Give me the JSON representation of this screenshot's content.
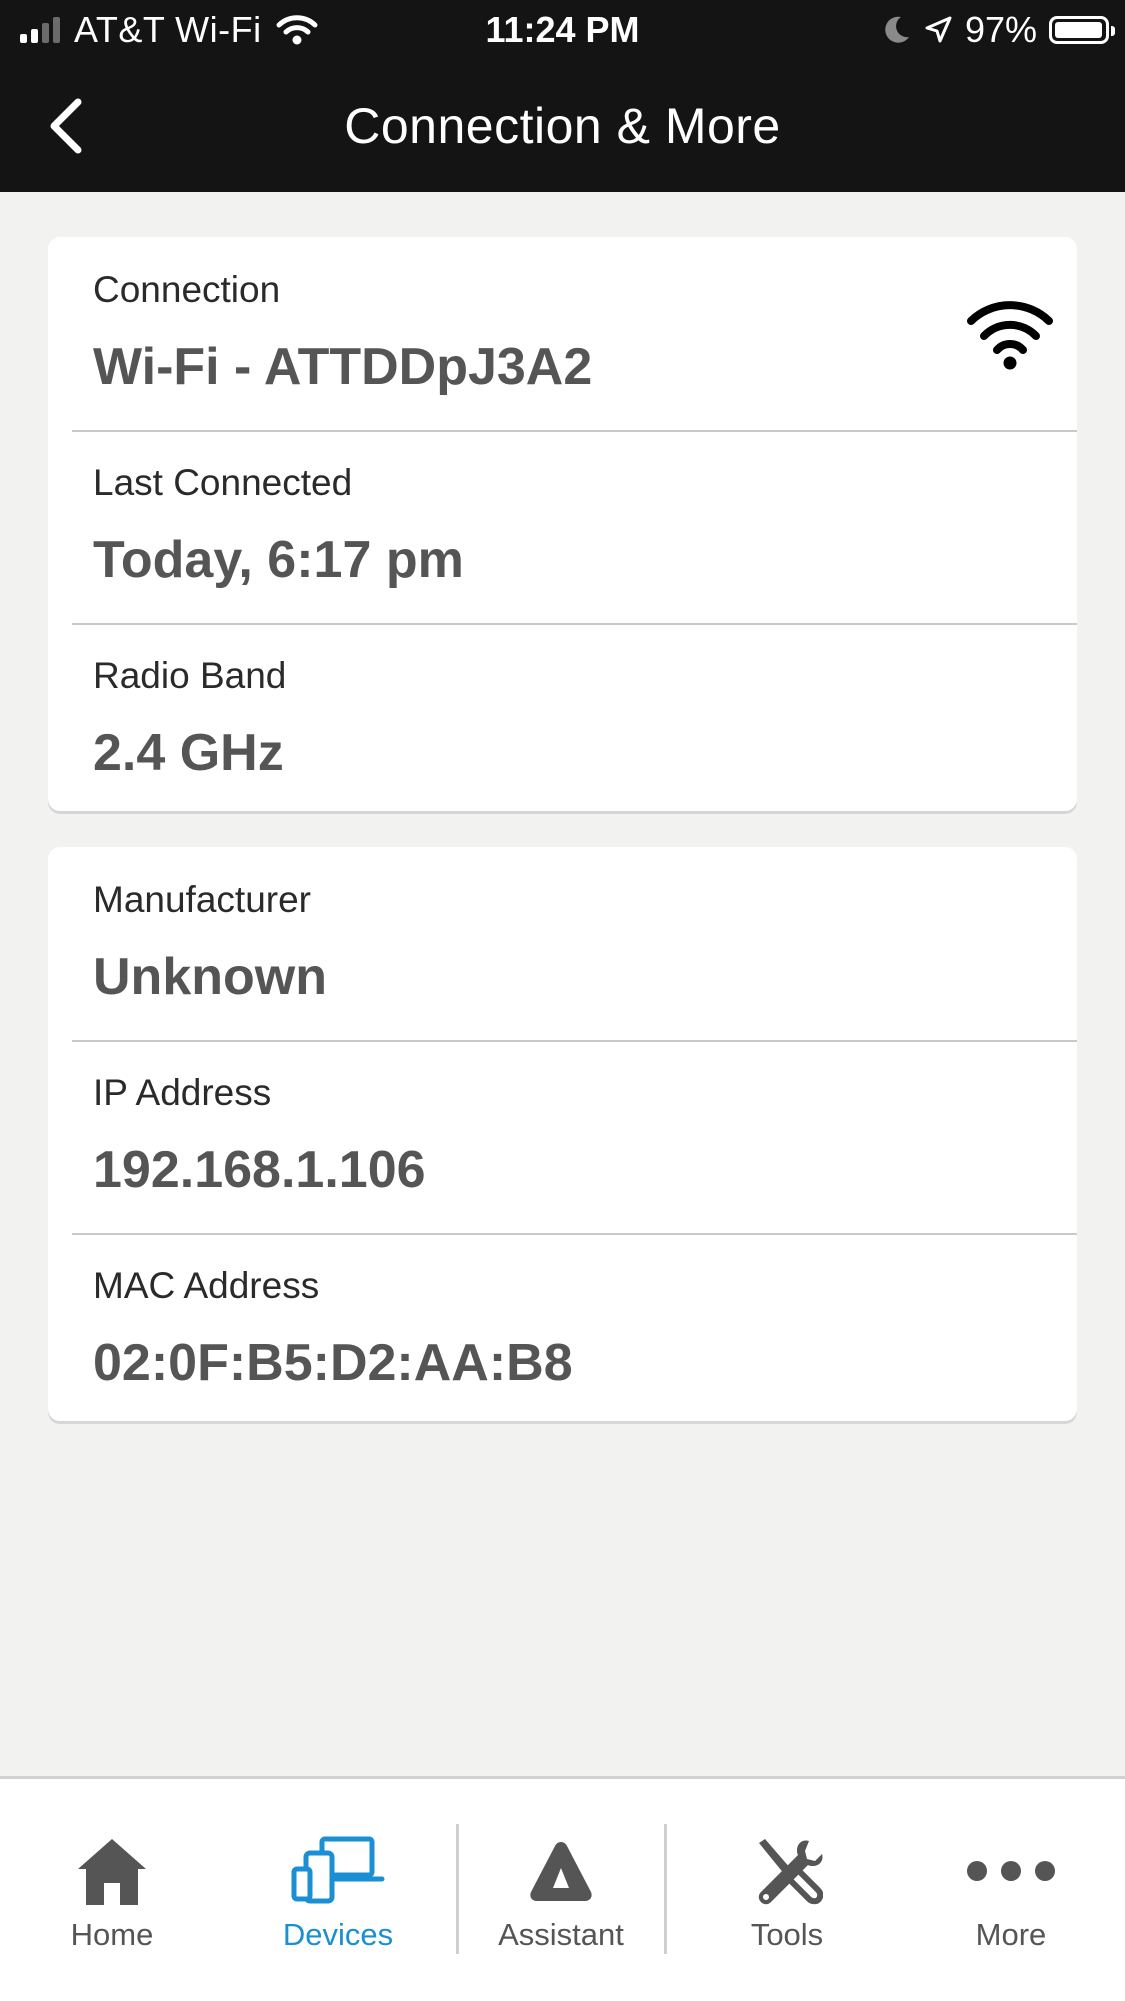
{
  "status_bar": {
    "carrier": "AT&T Wi-Fi",
    "time": "11:24 PM",
    "battery_percent_label": "97%",
    "battery_level": 0.97,
    "signal_bars_active": 2,
    "icons": [
      "signal-icon",
      "wifi-icon",
      "moon-icon",
      "location-arrow-icon",
      "battery-icon"
    ]
  },
  "header": {
    "title": "Connection & More",
    "back_icon": "chevron-left-icon"
  },
  "connection_card": {
    "connection": {
      "label": "Connection",
      "value": "Wi-Fi - ATTDDpJ3A2",
      "icon": "wifi-icon"
    },
    "last_connected": {
      "label": "Last Connected",
      "value": "Today, 6:17 pm"
    },
    "radio_band": {
      "label": "Radio Band",
      "value": "2.4 GHz"
    }
  },
  "device_card": {
    "manufacturer": {
      "label": "Manufacturer",
      "value": "Unknown"
    },
    "ip_address": {
      "label": "IP Address",
      "value": "192.168.1.106"
    },
    "mac_address": {
      "label": "MAC Address",
      "value": "02:0F:B5:D2:AA:B8"
    }
  },
  "tab_bar": {
    "active_tab": "Devices",
    "accent_color": "#1a8fd3",
    "tabs": [
      {
        "label": "Home",
        "icon": "home-icon"
      },
      {
        "label": "Devices",
        "icon": "devices-icon"
      },
      {
        "label": "Assistant",
        "icon": "assistant-icon"
      },
      {
        "label": "Tools",
        "icon": "tools-icon"
      },
      {
        "label": "More",
        "icon": "more-dots-icon"
      }
    ]
  }
}
